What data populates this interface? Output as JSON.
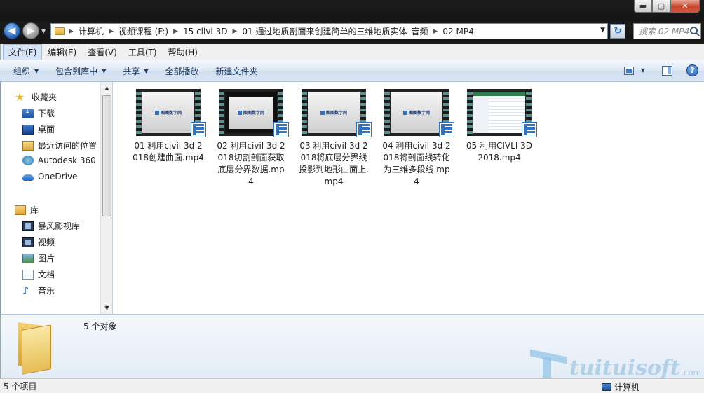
{
  "window": {
    "minimize": "▬",
    "maximize": "▢",
    "close": "✕"
  },
  "navigation": {
    "back": "◀",
    "forward": "▶",
    "history_dropdown": "▼",
    "refresh": "↻"
  },
  "address_bar": {
    "crumbs": [
      "计算机",
      "视频课程 (F:)",
      "15 cilvi 3D",
      "01 通过地质剖面来创建简单的三维地质实体_音频",
      "02 MP4"
    ],
    "separator": "▶",
    "dropdown": "▼"
  },
  "search": {
    "placeholder": "搜索 02 MP4"
  },
  "menu": {
    "items": [
      "文件(F)",
      "编辑(E)",
      "查看(V)",
      "工具(T)",
      "帮助(H)"
    ]
  },
  "command_bar": {
    "organize": "组织",
    "include_in_library": "包含到库中",
    "share": "共享",
    "play_all": "全部播放",
    "new_folder": "新建文件夹",
    "caret": "▼",
    "help": "?"
  },
  "nav_pane": {
    "favorites_header": "收藏夹",
    "favorites": [
      "下载",
      "桌面",
      "最近访问的位置",
      "Autodesk 360",
      "OneDrive"
    ],
    "libraries_header": "库",
    "libraries": [
      "暴风影视库",
      "视频",
      "图片",
      "文档",
      "音乐"
    ]
  },
  "files": [
    {
      "name": "01 利用civil 3d 2018创建曲面.mp4",
      "thumb": "slide"
    },
    {
      "name": "02 利用civil 3d 2018切割剖面获取底层分界数据.mp4",
      "thumb": "dark"
    },
    {
      "name": "03 利用civil 3d 2018将底层分界线投影到地形曲面上.mp4",
      "thumb": "slide"
    },
    {
      "name": "04 利用civil 3d 2018将剖面线转化为三维多段线.mp4",
      "thumb": "slide"
    },
    {
      "name": "05 利用CIVLI 3D 2018.mp4",
      "thumb": "sheet"
    }
  ],
  "thumb_logo": "图图数字网",
  "details": {
    "count": "5 个对象"
  },
  "watermark": {
    "text": "tuituisoft",
    "suffix": ".com"
  },
  "status": {
    "items": "5 个项目",
    "location": "计算机"
  },
  "colors": {
    "accent": "#2f73c2",
    "titlebar": "#1b1b1b",
    "command_bar": "#dce7f4"
  }
}
